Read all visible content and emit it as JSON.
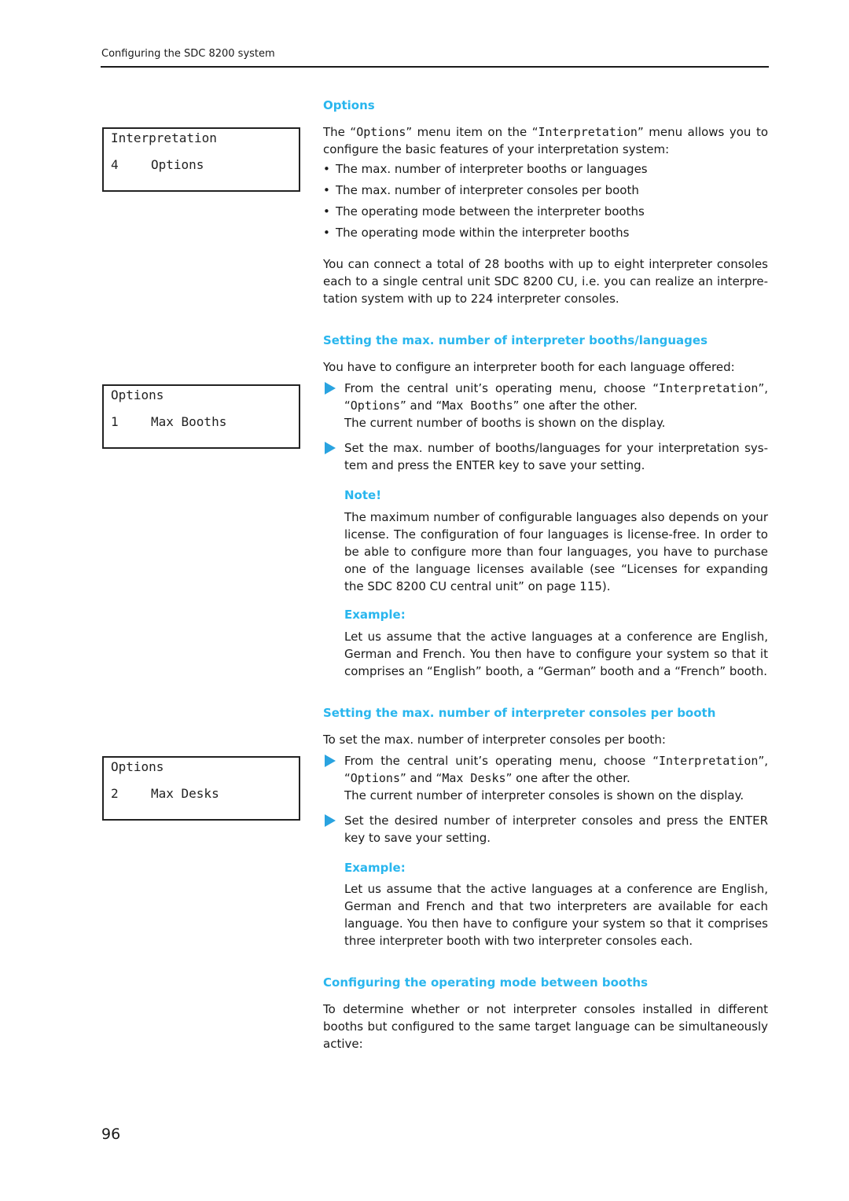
{
  "header": {
    "title": "Configuring the SDC 8200 system"
  },
  "lcd_displays": [
    {
      "line1": "Interpretation",
      "number": "4",
      "item": "Options"
    },
    {
      "line1": "Options",
      "number": "1",
      "item": "Max Booths"
    },
    {
      "line1": "Options",
      "number": "2",
      "item": "Max Desks"
    }
  ],
  "sections": {
    "options": {
      "heading": "Options",
      "intro_pre": "The “",
      "intro_m1": "Options",
      "intro_mid": "” menu item on the “",
      "intro_m2": "Interpretation",
      "intro_post": "” menu allows you to configure the basic features of your interpretation system:",
      "bullets": [
        "The max. number of interpreter booths or languages",
        "The max. number of interpreter consoles per booth",
        "The operating mode between the interpreter booths",
        "The operating mode within the interpreter booths"
      ],
      "paragraph": "You can connect a total of 28 booths with up to eight interpreter consoles each to a single central unit SDC 8200 CU, i.e. you can realize an interpre-tation system with up to 224 interpreter consoles."
    },
    "booths": {
      "heading": "Setting the max. number of interpreter booths/languages",
      "intro": "You have to configure an interpreter booth for each language offered:",
      "step1_pre": "From the central unit’s operating menu, choose “",
      "step1_m1": "Interpretation",
      "step1_sep1": "”, “",
      "step1_m2": "Options",
      "step1_sep2": "” and “",
      "step1_m3": "Max Booths",
      "step1_post": "” one after the other.",
      "step1_result": "The current number of booths is shown on the display.",
      "step2": "Set the max. number of booths/languages for your interpretation sys-tem and press the ENTER key to save your setting.",
      "note_heading": "Note!",
      "note_text": "The maximum number of configurable languages also depends on your license. The configuration of four languages is license-free. In order to be able to configure more than four languages, you have to purchase one of the language licenses available (see “Licenses for expanding the SDC 8200 CU central unit” on page 115).",
      "example_heading": "Example:",
      "example_text": "Let us assume that the active languages at a conference are English, German and French. You then have to configure your system so that it comprises an “English” booth, a “German” booth and a “French” booth."
    },
    "consoles": {
      "heading": "Setting the max. number of interpreter consoles per booth",
      "intro": "To set the max. number of interpreter consoles per booth:",
      "step1_pre": "From the central unit’s operating menu, choose “",
      "step1_m1": "Interpretation",
      "step1_sep1": "”, “",
      "step1_m2": "Options",
      "step1_sep2": "” and “",
      "step1_m3": "Max Desks",
      "step1_post": "” one after the other.",
      "step1_result": "The current number of interpreter consoles is shown on the display.",
      "step2": "Set the desired number of interpreter consoles and press the ENTER key to save your setting.",
      "example_heading": "Example:",
      "example_text": "Let us assume that the active languages at a conference are English, German and French and that two interpreters are available for each language. You then have to configure your system so that it comprises three interpreter booth with two interpreter consoles each."
    },
    "operating_mode": {
      "heading": "Configuring the operating mode between booths",
      "text": "To determine whether or not interpreter consoles installed in different booths but configured to the same target language can be simultaneously active:"
    }
  },
  "page_number": "96",
  "colors": {
    "accent": "#29b6ee",
    "text": "#1a1a1a"
  }
}
